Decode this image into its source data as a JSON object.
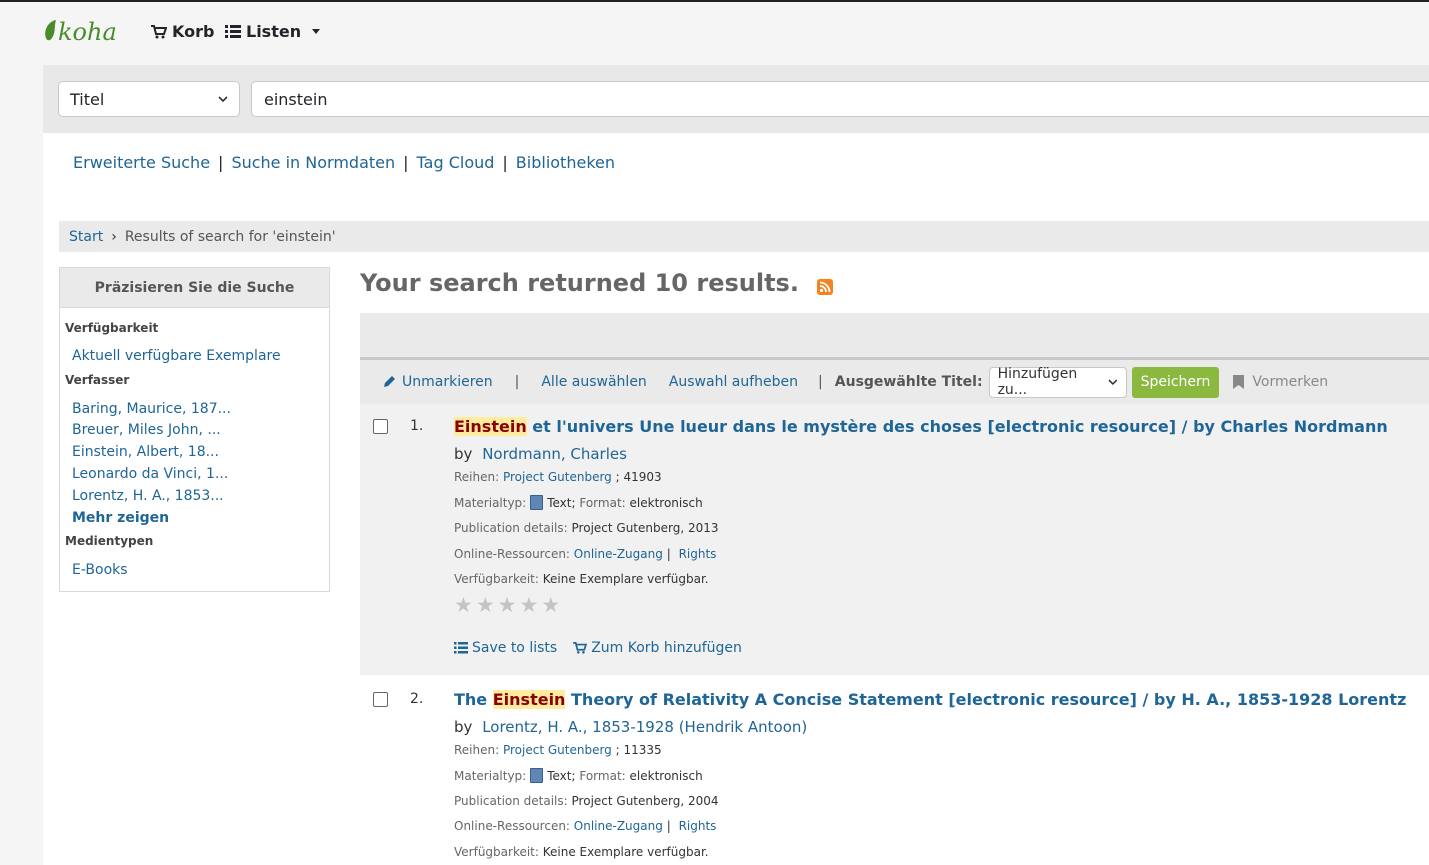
{
  "header": {
    "logo_text": "koha",
    "cart_label": "Korb",
    "lists_label": "Listen"
  },
  "search": {
    "index_selected": "Titel",
    "query": "einstein"
  },
  "moresearches": {
    "advanced": "Erweiterte Suche",
    "authorities": "Suche in Normdaten",
    "tagcloud": "Tag Cloud",
    "libraries": "Bibliotheken"
  },
  "breadcrumb": {
    "home": "Start",
    "current": "Results of search for 'einstein'"
  },
  "facets": {
    "heading": "Präzisieren Sie die Suche",
    "availability_title": "Verfügbarkeit",
    "availability_item": "Aktuell verfügbare Exemplare",
    "authors_title": "Verfasser",
    "authors": [
      "Baring, Maurice, 187...",
      "Breuer, Miles John, ...",
      "Einstein, Albert, 18...",
      "Leonardo da Vinci, 1...",
      "Lorentz, H. A., 1853..."
    ],
    "show_more": "Mehr zeigen",
    "itemtypes_title": "Medientypen",
    "itemtypes_item": "E-Books"
  },
  "results_header": {
    "summary": "Your search returned 10 results."
  },
  "toolbar": {
    "unmark": "Unmarkieren",
    "select_all": "Alle auswählen",
    "clear_all": "Auswahl aufheben",
    "selected_label": "Ausgewählte Titel:",
    "add_to": "Hinzufügen zu...",
    "save": "Speichern",
    "place_hold": "Vormerken"
  },
  "labels": {
    "by": "by",
    "series": "Reihen:",
    "material_type": "Materialtyp:",
    "format": "Format:",
    "pub_details": "Publication details:",
    "online": "Online-Ressourcen:",
    "availability": "Verfügbarkeit:"
  },
  "results": [
    {
      "number": "1.",
      "title_prefix": "",
      "title_highlight": "Einstein",
      "title_rest": " et l'univers Une lueur dans le mystère des choses [electronic resource] / by Charles Nordmann",
      "author": "Nordmann, Charles",
      "series_name": "Project Gutenberg",
      "series_num": "; 41903",
      "material": "Text",
      "format": "elektronisch",
      "publication": "Project Gutenberg, 2013",
      "online_link": "Online-Zugang",
      "rights_link": "Rights",
      "availability": "Keine Exemplare verfügbar.",
      "rating": 0,
      "save_to_lists": "Save to lists",
      "add_to_cart": "Zum Korb hinzufügen"
    },
    {
      "number": "2.",
      "title_prefix": "The ",
      "title_highlight": "Einstein",
      "title_rest": " Theory of Relativity A Concise Statement [electronic resource] / by H. A., 1853-1928 Lorentz",
      "author": "Lorentz, H. A., 1853-1928 (Hendrik Antoon)",
      "series_name": "Project Gutenberg",
      "series_num": "; 11335",
      "material": "Text",
      "format": "elektronisch",
      "publication": "Project Gutenberg, 2004",
      "online_link": "Online-Zugang",
      "rights_link": "Rights",
      "availability": "Keine Exemplare verfügbar."
    }
  ],
  "colors": {
    "link": "#1f6596",
    "logo_green": "#4a8c2a",
    "save_button": "#8bb83f",
    "highlight_bg": "#ffec9f",
    "rss": "#f5821f"
  },
  "icons": {
    "cart": "shopping-cart-icon",
    "lists": "list-icon",
    "rss": "rss-icon",
    "pencil": "pencil-icon",
    "bookmark": "bookmark-icon",
    "book": "book-icon",
    "star": "star-icon"
  }
}
